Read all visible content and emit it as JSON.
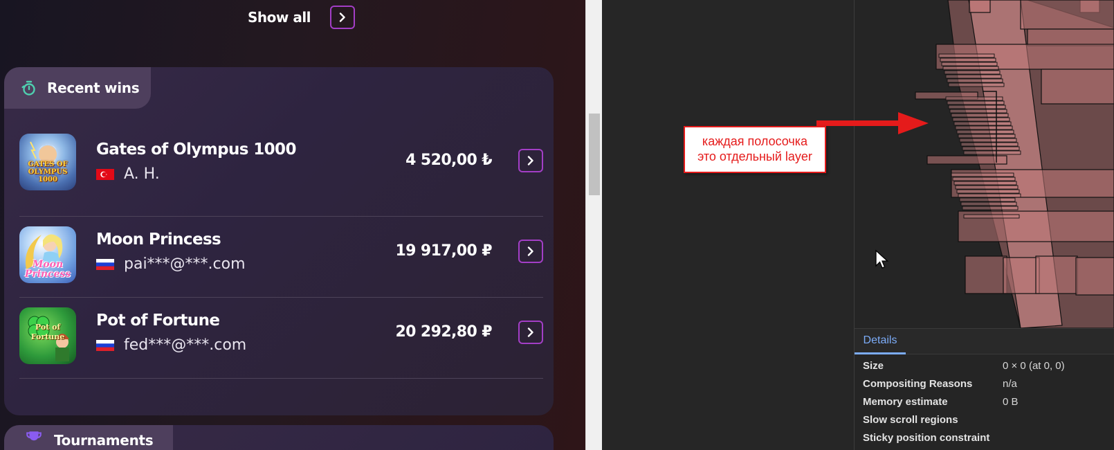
{
  "casino": {
    "show_all": {
      "label": "Show all"
    },
    "recent_wins": {
      "title": "Recent wins",
      "icon": "stopwatch-icon",
      "items": [
        {
          "game": "Gates of Olympus 1000",
          "thumb_text": "GATES OF OLYMPUS 1000",
          "player": "A. H.",
          "country": "Turkey",
          "amount": "4 520,00 ₺"
        },
        {
          "game": "Moon Princess",
          "thumb_text": "Moon Princess",
          "player": "pai***@***.com",
          "country": "Russia",
          "amount": "19 917,00 ₽"
        },
        {
          "game": "Pot of Fortune",
          "thumb_text": "Pot of Fortune",
          "player": "fed***@***.com",
          "country": "Russia",
          "amount": "20 292,80 ₽"
        }
      ]
    },
    "tournaments": {
      "title": "Tournaments",
      "icon": "trophy-icon"
    }
  },
  "colors": {
    "accent": "#a33ec6",
    "stopwatch_icon": "#4fd1b0",
    "layer_fill": "#c07878",
    "annotation_red": "#e51b1b",
    "details_tab_blue": "#7cacf8"
  },
  "devtools": {
    "annotation": {
      "line1": "каждая полосочка",
      "line2": "это отдельный layer"
    },
    "details": {
      "tab": "Details",
      "rows": [
        {
          "key": "Size",
          "value": "0 × 0 (at 0, 0)"
        },
        {
          "key": "Compositing Reasons",
          "value": "n/a"
        },
        {
          "key": "Memory estimate",
          "value": "0 B"
        },
        {
          "key": "Slow scroll regions",
          "value": ""
        },
        {
          "key": "Sticky position constraint",
          "value": ""
        }
      ]
    }
  }
}
